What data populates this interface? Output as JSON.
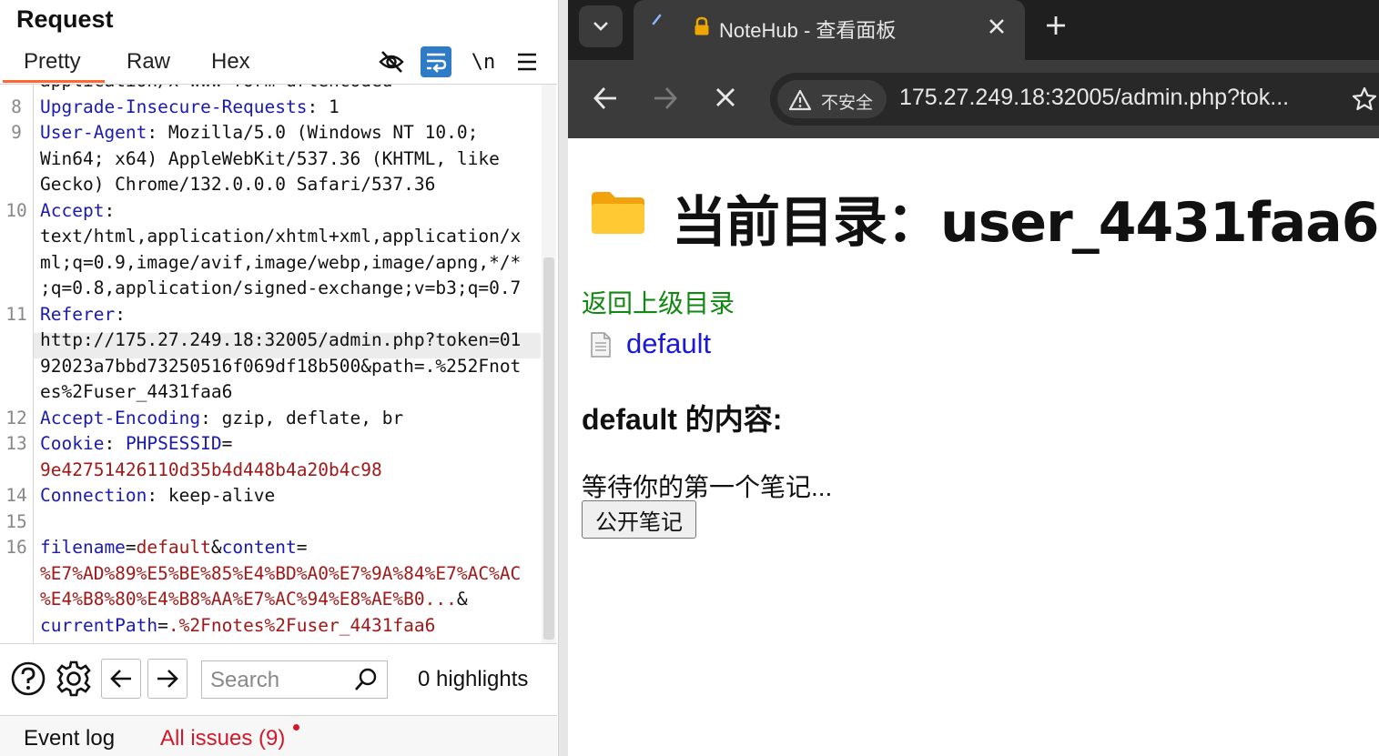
{
  "burp": {
    "title": "Request",
    "tabs": [
      "Pretty",
      "Raw",
      "Hex"
    ],
    "toolbar_icons": [
      "eye-off-icon",
      "wrap-icon",
      "newline-icon",
      "menu-icon"
    ],
    "newline_label": "\\n",
    "lines": [
      {
        "num": "",
        "parts": [
          {
            "t": "application/x-www-form-urlencoded",
            "c": "val"
          }
        ]
      },
      {
        "num": "8",
        "parts": [
          {
            "t": "Upgrade-Insecure-Requests",
            "c": "key"
          },
          {
            "t": ": 1",
            "c": "val"
          }
        ]
      },
      {
        "num": "9",
        "parts": [
          {
            "t": "User-Agent",
            "c": "key"
          },
          {
            "t": ": Mozilla/5.0 (Windows NT 10.0;",
            "c": "val"
          }
        ]
      },
      {
        "num": "",
        "parts": [
          {
            "t": "Win64; x64) AppleWebKit/537.36 (KHTML, like",
            "c": "val"
          }
        ]
      },
      {
        "num": "",
        "parts": [
          {
            "t": "Gecko) Chrome/132.0.0.0 Safari/537.36",
            "c": "val"
          }
        ]
      },
      {
        "num": "10",
        "parts": [
          {
            "t": "Accept",
            "c": "key"
          },
          {
            "t": ":",
            "c": "val"
          }
        ]
      },
      {
        "num": "",
        "parts": [
          {
            "t": "text/html,application/xhtml+xml,application/x",
            "c": "val"
          }
        ]
      },
      {
        "num": "",
        "parts": [
          {
            "t": "ml;q=0.9,image/avif,image/webp,image/apng,*/*",
            "c": "val"
          }
        ]
      },
      {
        "num": "",
        "parts": [
          {
            "t": ";q=0.8,application/signed-exchange;v=b3;q=0.7",
            "c": "val"
          }
        ]
      },
      {
        "num": "11",
        "parts": [
          {
            "t": "Referer",
            "c": "key"
          },
          {
            "t": ":",
            "c": "val"
          }
        ]
      },
      {
        "num": "",
        "parts": [
          {
            "t": "http://175.27.249.18:32005/admin.php?token=01",
            "c": "val"
          }
        ]
      },
      {
        "num": "",
        "parts": [
          {
            "t": "92023a7bbd73250516f069df18b500&path=.%252Fnot",
            "c": "val"
          }
        ]
      },
      {
        "num": "",
        "parts": [
          {
            "t": "es%2Fuser_4431faa6",
            "c": "val"
          }
        ]
      },
      {
        "num": "12",
        "parts": [
          {
            "t": "Accept-Encoding",
            "c": "key"
          },
          {
            "t": ": gzip, deflate, br",
            "c": "val"
          }
        ]
      },
      {
        "num": "13",
        "parts": [
          {
            "t": "Cookie",
            "c": "key"
          },
          {
            "t": ": ",
            "c": "val"
          },
          {
            "t": "PHPSESSID",
            "c": "blu"
          },
          {
            "t": "=",
            "c": "val"
          }
        ]
      },
      {
        "num": "",
        "parts": [
          {
            "t": "9e42751426110d35b4d448b4a20b4c98",
            "c": "red"
          }
        ]
      },
      {
        "num": "14",
        "parts": [
          {
            "t": "Connection",
            "c": "key"
          },
          {
            "t": ": keep-alive",
            "c": "val"
          }
        ]
      },
      {
        "num": "15",
        "parts": []
      },
      {
        "num": "16",
        "parts": [
          {
            "t": "filename",
            "c": "blu"
          },
          {
            "t": "=",
            "c": "val"
          },
          {
            "t": "default",
            "c": "red"
          },
          {
            "t": "&",
            "c": "val"
          },
          {
            "t": "content",
            "c": "blu"
          },
          {
            "t": "=",
            "c": "val"
          }
        ]
      },
      {
        "num": "",
        "parts": [
          {
            "t": "%E7%AD%89%E5%BE%85%E4%BD%A0%E7%9A%84%E7%AC%AC",
            "c": "red"
          }
        ]
      },
      {
        "num": "",
        "parts": [
          {
            "t": "%E4%B8%80%E4%B8%AA%E7%AC%94%E8%AE%B0...",
            "c": "red"
          },
          {
            "t": "&",
            "c": "val"
          }
        ]
      },
      {
        "num": "",
        "parts": [
          {
            "t": "currentPath",
            "c": "blu"
          },
          {
            "t": "=",
            "c": "val"
          },
          {
            "t": ".%2Fnotes%2Fuser_4431faa6",
            "c": "red"
          }
        ]
      }
    ],
    "search": {
      "placeholder": "Search"
    },
    "highlights": "0 highlights",
    "status": {
      "event_log": "Event log",
      "all_issues": "All issues (9)"
    }
  },
  "browser": {
    "tab_title": "NoteHub - 查看面板",
    "security_label": "不安全",
    "url": "175.27.249.18:32005/admin.php?tok...",
    "page": {
      "heading": "当前目录：user_4431faa6",
      "back_link": "返回上级目录",
      "file_link": "default",
      "content_heading": "default 的内容:",
      "note_text": "等待你的第一个笔记...",
      "publish_button": "公开笔记"
    }
  }
}
